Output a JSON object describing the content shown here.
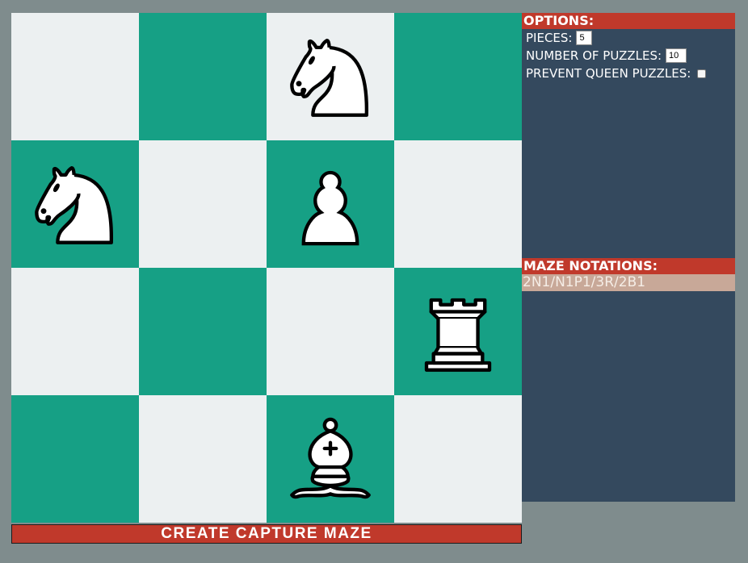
{
  "colors": {
    "background": "#7f8c8d",
    "light_square": "#ecf0f1",
    "dark_square": "#16a085",
    "accent": "#c0392b",
    "panel": "#34495e",
    "notation_bg": "#c8a898"
  },
  "board": {
    "rows": [
      [
        {
          "color": "light",
          "piece": null
        },
        {
          "color": "dark",
          "piece": null
        },
        {
          "color": "light",
          "piece": "knight-icon"
        },
        {
          "color": "dark",
          "piece": null
        }
      ],
      [
        {
          "color": "dark",
          "piece": "knight-icon"
        },
        {
          "color": "light",
          "piece": null
        },
        {
          "color": "dark",
          "piece": "pawn-icon"
        },
        {
          "color": "light",
          "piece": null
        }
      ],
      [
        {
          "color": "light",
          "piece": null
        },
        {
          "color": "dark",
          "piece": null
        },
        {
          "color": "light",
          "piece": null
        },
        {
          "color": "dark",
          "piece": "rook-icon"
        }
      ],
      [
        {
          "color": "dark",
          "piece": null
        },
        {
          "color": "light",
          "piece": null
        },
        {
          "color": "dark",
          "piece": "bishop-icon"
        },
        {
          "color": "light",
          "piece": null
        }
      ]
    ]
  },
  "create_button": {
    "label": "CREATE CAPTURE MAZE"
  },
  "options": {
    "header": "OPTIONS:",
    "pieces_label": "PIECES:",
    "pieces_value": "5",
    "puzzles_label": "NUMBER OF PUZZLES:",
    "puzzles_value": "10",
    "prevent_queen_label": "PREVENT QUEEN PUZZLES:",
    "prevent_queen_checked": false
  },
  "maze": {
    "header": "MAZE NOTATIONS:",
    "notation": "2N1/N1P1/3R/2B1"
  }
}
